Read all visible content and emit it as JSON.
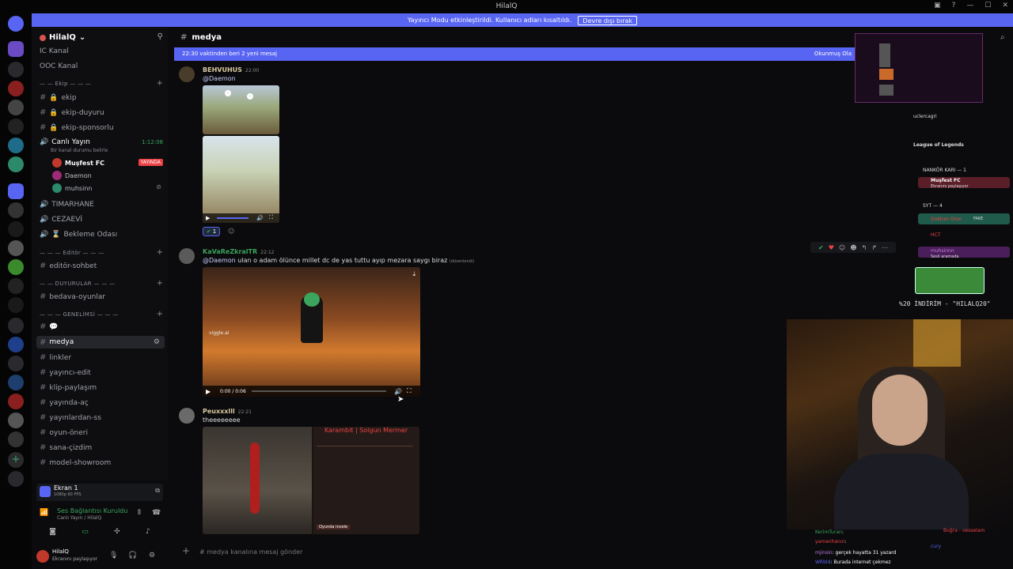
{
  "window": {
    "title": "HilalQ"
  },
  "banner": {
    "text": "Yayıncı Modu etkinleştirildi. Kullanıcı adları kısaltıldı.",
    "button": "Devre dışı bırak"
  },
  "server": {
    "name": "HilalQ"
  },
  "channels": {
    "top": [
      "IC Kanal",
      "OOC Kanal"
    ],
    "cat_ekip": "Ekip",
    "ekip": [
      "ekip",
      "ekip-duyuru",
      "ekip-sponsorlu"
    ],
    "voice": {
      "name": "Canlı Yayın",
      "status": "Bir kanal durumu belirle",
      "time": "1:12:08",
      "users": [
        "Muşfest FC",
        "Daemon",
        "muhsinn"
      ],
      "live_label": "YAYINDA"
    },
    "extra": [
      "TIMARHANE",
      "CEZAEVİ",
      "Bekleme Odası"
    ],
    "cat_editor": "Editör",
    "editor": [
      "editör-sohbet"
    ],
    "cat_duyurular": "DUYURULAR",
    "duyurular": [
      "bedava-oyunlar"
    ],
    "cat_genel": "GENELİMSİ",
    "genel": [
      "medya",
      "linkler",
      "yayıncı-edit",
      "klip-paylaşım",
      "yayında-aç",
      "yayınlardan-ss",
      "oyun-öneri",
      "sana-çizdim",
      "model-showroom"
    ]
  },
  "screen_share": {
    "label": "Ekran 1",
    "quality": "1080p 60 FPS"
  },
  "voice_status": {
    "title": "Ses Bağlantısı Kuruldu",
    "sub": "Canlı Yayın / HilalQ"
  },
  "user": {
    "name": "HilalQ",
    "status": "Ekranını paylaşıyor"
  },
  "header": {
    "channel": "medya"
  },
  "new_messages": {
    "text": "22:30 vaktinden beri 2 yeni mesaj",
    "action": "Okunmuş Ola"
  },
  "messages": [
    {
      "author": "BEHVUHUS",
      "time": "22:00",
      "text": "@Daemon",
      "reaction_count": "1"
    },
    {
      "author": "KaVaReZkralTR",
      "time": "22:12",
      "mention": "@Daemon",
      "text": " ulan o adam ölünce millet dc de yas tuttu ayıp mezara saygı biraz",
      "edited": "(düzenlendi)",
      "video_time": "0:00 / 0:06",
      "watermark": "viggle.ai"
    },
    {
      "author": "Peuxxxlll",
      "time": "22:21",
      "text": "theeeeeeee",
      "card_title": "Karambit | Solgun Mermer",
      "card_sub": "Oyunda incele"
    }
  ],
  "composer": {
    "placeholder": "# medya kanalına mesaj gönder"
  },
  "overlay": {
    "lines": [
      "uclercagri",
      "League of Legends",
      "NANKÖR KARI — 1",
      "Muşfest FC",
      "Ekranını paylaşıyor",
      "SYT — 4",
      "Gokhan Onor",
      "HCT",
      "muhsinnn",
      "Sesli aramada"
    ],
    "promo": "%20 İNDİRİM - \"HILALQ20\"",
    "fake": "FAKE"
  },
  "chat": [
    {
      "user": "KerimTuran",
      "text": ":"
    },
    {
      "user": "yamanhanın",
      "text": ":"
    },
    {
      "user": "mjinsin",
      "text": ": gerçek hayatta 31 yazard"
    },
    {
      "user": "WRbld",
      "text": ": Burada internet çekmez"
    },
    {
      "user": "Buğra - vesselam",
      "text": ""
    },
    {
      "user": "cury",
      "text": ""
    }
  ],
  "colors": {
    "accent": "#5865f2",
    "live": "#ed4245",
    "brand_purple": "#7b2fbf"
  }
}
